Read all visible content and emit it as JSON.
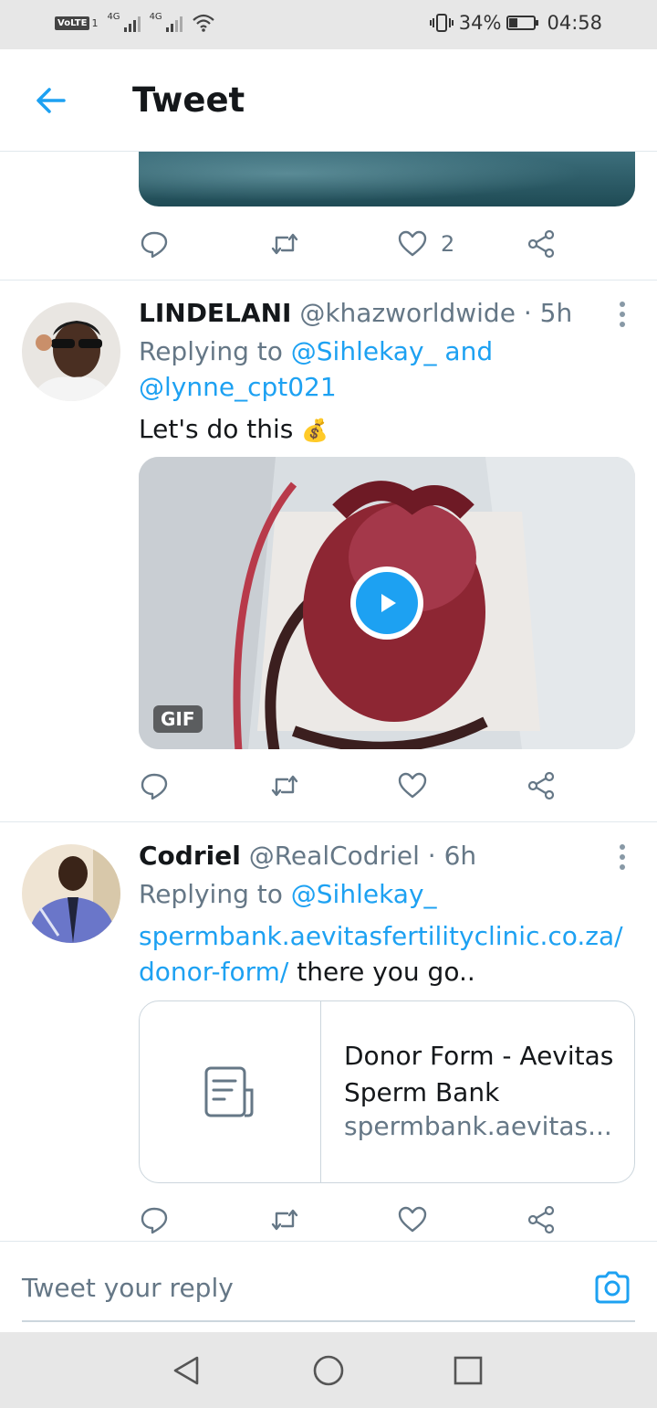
{
  "status_bar": {
    "volte": "VoLTE",
    "sim": "1",
    "net1": "4G",
    "net2": "4G",
    "battery": "34%",
    "time": "04:58"
  },
  "header": {
    "title": "Tweet"
  },
  "tweets": [
    {
      "actions": {
        "like_count": "2"
      }
    },
    {
      "name": "LINDELANI",
      "handle": "@khazworldwide",
      "sep": "·",
      "age": "5h",
      "replying_prefix": "Replying to ",
      "reply_user1": "@Sihlekay_",
      "reply_and": " and",
      "reply_user2": "@lynne_cpt021",
      "text": "Let's do this",
      "emoji": "💰",
      "media_tag": "GIF"
    },
    {
      "name": "Codriel",
      "handle": "@RealCodriel",
      "sep": "·",
      "age": "6h",
      "replying_prefix": "Replying to ",
      "reply_user1": "@Sihlekay_",
      "link_line1": "spermbank.aevitasfertilityclinic.co.za/",
      "link_line2": "donor-form/",
      "text_after": " there you go..",
      "card": {
        "title": "Donor Form - Aevitas Sperm Bank",
        "url": "spermbank.aevitas..."
      }
    }
  ],
  "reply_box": {
    "placeholder": "Tweet your reply"
  },
  "colors": {
    "accent": "#1da1f2",
    "muted": "#657786",
    "text": "#14171a"
  },
  "icons": [
    "back-arrow-icon",
    "reply-icon",
    "retweet-icon",
    "like-icon",
    "share-icon",
    "more-icon",
    "play-icon",
    "document-icon",
    "camera-icon",
    "nav-back-icon",
    "nav-home-icon",
    "nav-recents-icon"
  ]
}
